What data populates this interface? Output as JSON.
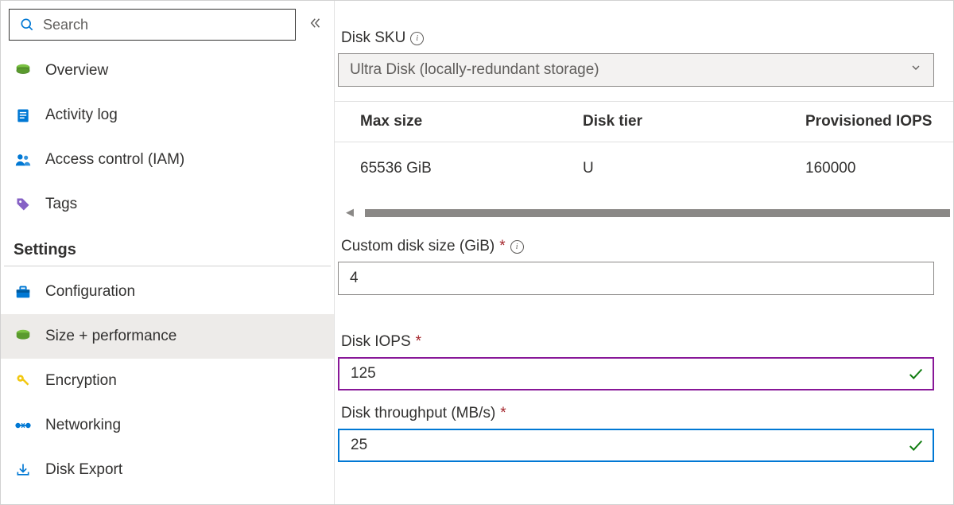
{
  "search": {
    "placeholder": "Search"
  },
  "nav": {
    "items": [
      {
        "label": "Overview"
      },
      {
        "label": "Activity log"
      },
      {
        "label": "Access control (IAM)"
      },
      {
        "label": "Tags"
      }
    ],
    "section": "Settings",
    "settings_items": [
      {
        "label": "Configuration"
      },
      {
        "label": "Size + performance"
      },
      {
        "label": "Encryption"
      },
      {
        "label": "Networking"
      },
      {
        "label": "Disk Export"
      }
    ]
  },
  "main": {
    "disk_sku": {
      "label": "Disk SKU",
      "value": "Ultra Disk (locally-redundant storage)"
    },
    "table": {
      "headers": {
        "c1": "Max size",
        "c2": "Disk tier",
        "c3": "Provisioned IOPS"
      },
      "row": {
        "c1": "65536 GiB",
        "c2": "U",
        "c3": "160000"
      }
    },
    "custom_size": {
      "label": "Custom disk size (GiB)",
      "value": "4"
    },
    "iops": {
      "label": "Disk IOPS",
      "value": "125"
    },
    "throughput": {
      "label": "Disk throughput (MB/s)",
      "value": "25"
    }
  }
}
